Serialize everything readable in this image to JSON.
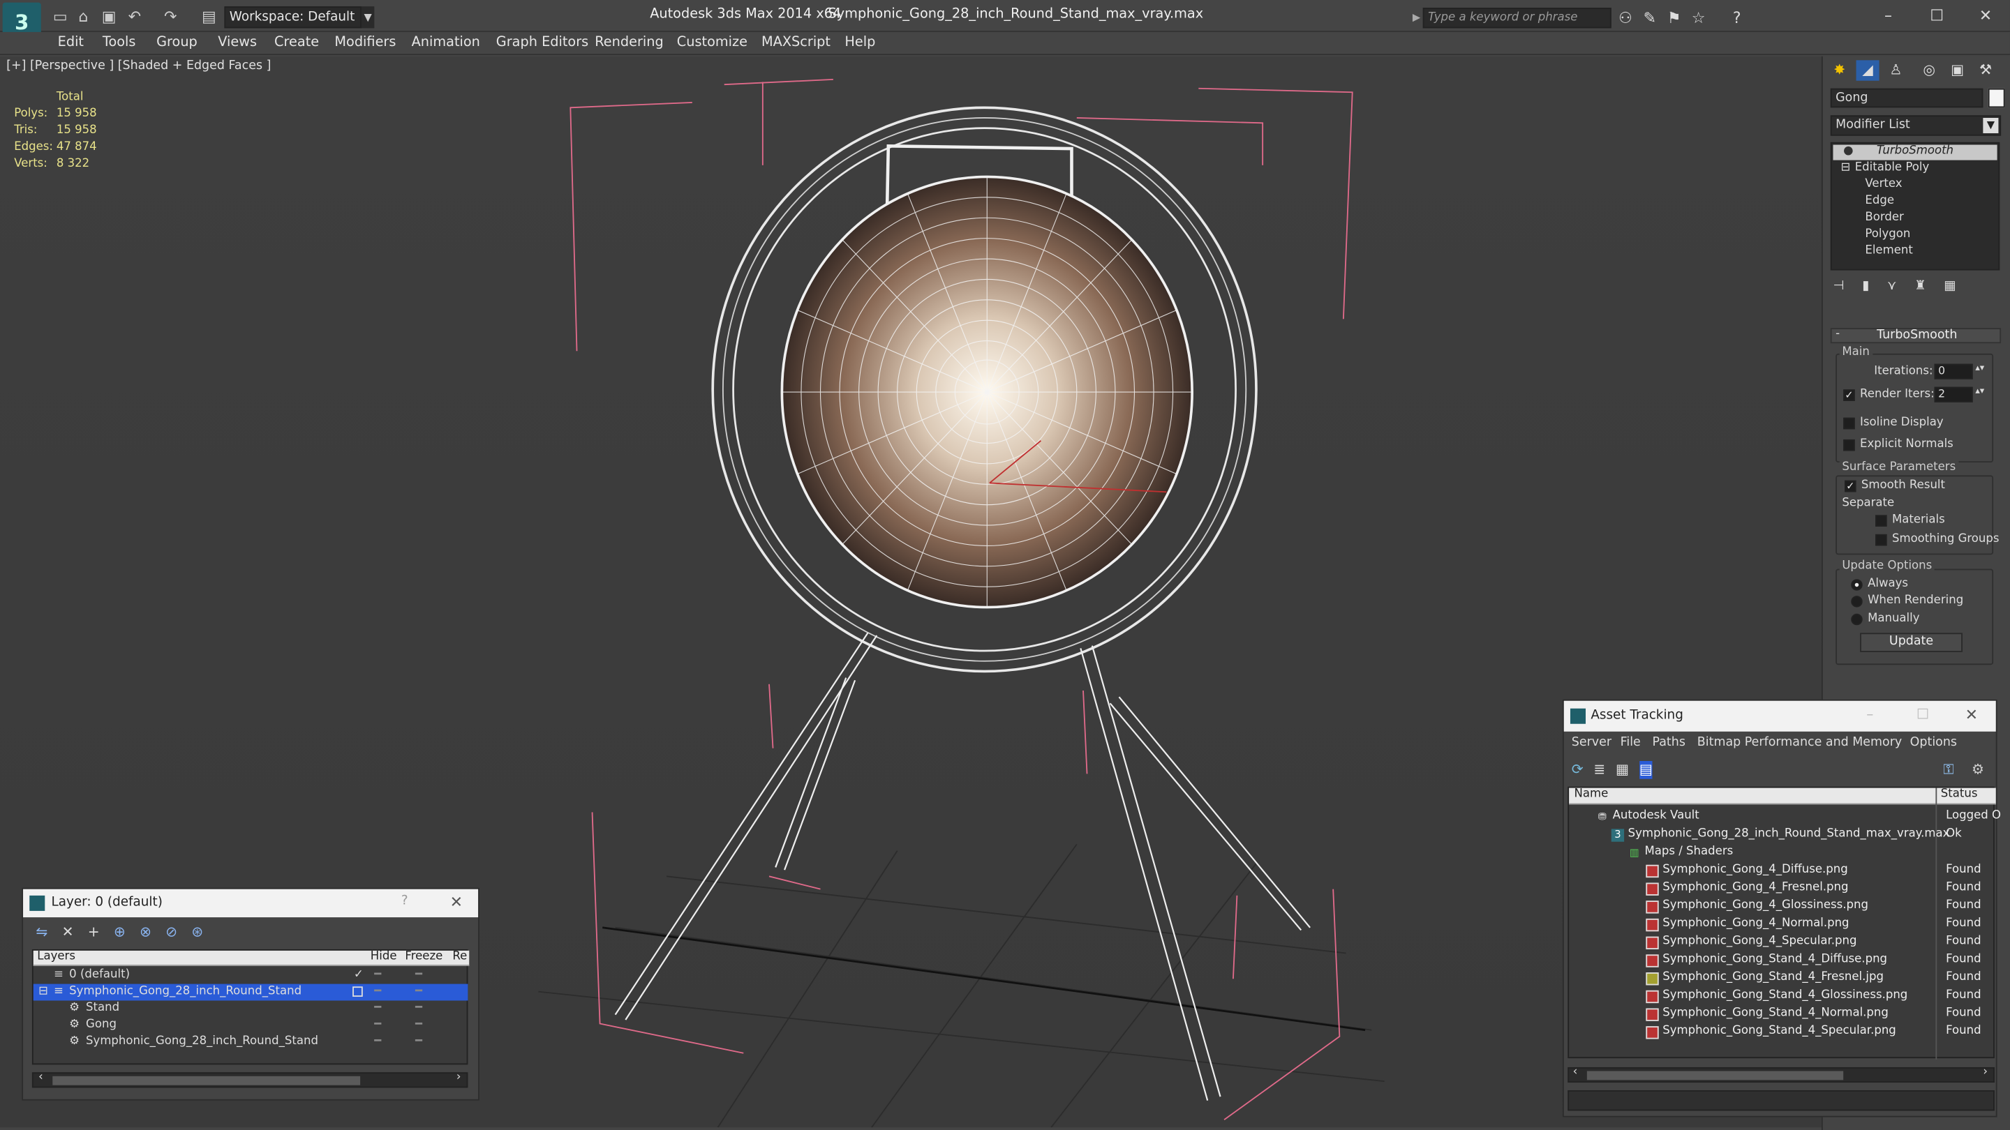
{
  "titlebar": {
    "logo": "3",
    "workspace": "Workspace: Default",
    "app_title": "Autodesk 3ds Max  2014 x64",
    "file_title": "Symphonic_Gong_28_inch_Round_Stand_max_vray.max",
    "search_placeholder": "Type a keyword or phrase"
  },
  "menu": [
    "Edit",
    "Tools",
    "Group",
    "Views",
    "Create",
    "Modifiers",
    "Animation",
    "Graph Editors",
    "Rendering",
    "Customize",
    "MAXScript",
    "Help"
  ],
  "viewport": {
    "label": "[+] [Perspective ] [Shaded + Edged Faces ]",
    "stats": {
      "header": "Total",
      "rows": [
        {
          "label": "Polys:",
          "value": "15 958"
        },
        {
          "label": "Tris:",
          "value": "15 958"
        },
        {
          "label": "Edges:",
          "value": "47 874"
        },
        {
          "label": "Verts:",
          "value": "8 322"
        }
      ]
    }
  },
  "command_panel": {
    "object_name": "Gong",
    "modifier_list": "Modifier List",
    "stack": {
      "turbosmooth": "TurboSmooth",
      "editable_poly": "Editable Poly",
      "subobjects": [
        "Vertex",
        "Edge",
        "Border",
        "Polygon",
        "Element"
      ]
    },
    "turbosmooth": {
      "header": "TurboSmooth",
      "main_group": "Main",
      "iterations_label": "Iterations:",
      "iterations_value": "0",
      "render_iters_label": "Render Iters:",
      "render_iters_value": "2",
      "isoline_display": "Isoline Display",
      "explicit_normals": "Explicit Normals",
      "surface_params": "Surface Parameters",
      "smooth_result": "Smooth Result",
      "separate": "Separate",
      "materials": "Materials",
      "smoothing_groups": "Smoothing Groups",
      "update_options": "Update Options",
      "always": "Always",
      "when_rendering": "When Rendering",
      "manually": "Manually",
      "update_button": "Update"
    }
  },
  "layer_window": {
    "title": "Layer: 0 (default)",
    "help": "?",
    "columns": {
      "layers": "Layers",
      "hide": "Hide",
      "freeze": "Freeze",
      "render": "Re"
    },
    "rows": [
      {
        "name": "0 (default)",
        "indent": 0,
        "selected": false
      },
      {
        "name": "Symphonic_Gong_28_inch_Round_Stand",
        "indent": 0,
        "selected": true
      },
      {
        "name": "Stand",
        "indent": 1,
        "selected": false
      },
      {
        "name": "Gong",
        "indent": 1,
        "selected": false
      },
      {
        "name": "Symphonic_Gong_28_inch_Round_Stand",
        "indent": 1,
        "selected": false
      }
    ]
  },
  "asset_tracking": {
    "title": "Asset Tracking",
    "menu": [
      "Server",
      "File",
      "Paths",
      "Bitmap Performance and Memory",
      "Options"
    ],
    "columns": {
      "name": "Name",
      "status": "Status"
    },
    "rows": [
      {
        "name": "Autodesk Vault",
        "status": "Logged O",
        "level": 0,
        "icon": "vault-icon"
      },
      {
        "name": "Symphonic_Gong_28_inch_Round_Stand_max_vray.max",
        "status": "Ok",
        "level": 1,
        "icon": "max-file-icon"
      },
      {
        "name": "Maps / Shaders",
        "status": "",
        "level": 2,
        "icon": "maps-folder-icon"
      },
      {
        "name": "Symphonic_Gong_4_Diffuse.png",
        "status": "Found",
        "level": 3,
        "icon": "png-icon"
      },
      {
        "name": "Symphonic_Gong_4_Fresnel.png",
        "status": "Found",
        "level": 3,
        "icon": "png-icon"
      },
      {
        "name": "Symphonic_Gong_4_Glossiness.png",
        "status": "Found",
        "level": 3,
        "icon": "png-icon"
      },
      {
        "name": "Symphonic_Gong_4_Normal.png",
        "status": "Found",
        "level": 3,
        "icon": "png-icon"
      },
      {
        "name": "Symphonic_Gong_4_Specular.png",
        "status": "Found",
        "level": 3,
        "icon": "png-icon"
      },
      {
        "name": "Symphonic_Gong_Stand_4_Diffuse.png",
        "status": "Found",
        "level": 3,
        "icon": "png-icon"
      },
      {
        "name": "Symphonic_Gong_Stand_4_Fresnel.jpg",
        "status": "Found",
        "level": 3,
        "icon": "jpg-icon"
      },
      {
        "name": "Symphonic_Gong_Stand_4_Glossiness.png",
        "status": "Found",
        "level": 3,
        "icon": "png-icon"
      },
      {
        "name": "Symphonic_Gong_Stand_4_Normal.png",
        "status": "Found",
        "level": 3,
        "icon": "png-icon"
      },
      {
        "name": "Symphonic_Gong_Stand_4_Specular.png",
        "status": "Found",
        "level": 3,
        "icon": "png-icon"
      }
    ]
  },
  "colors": {
    "selection_blue": "#2a5bd7",
    "stats_yellow": "#e8e28a",
    "bbox_pink": "#e06a8a"
  }
}
